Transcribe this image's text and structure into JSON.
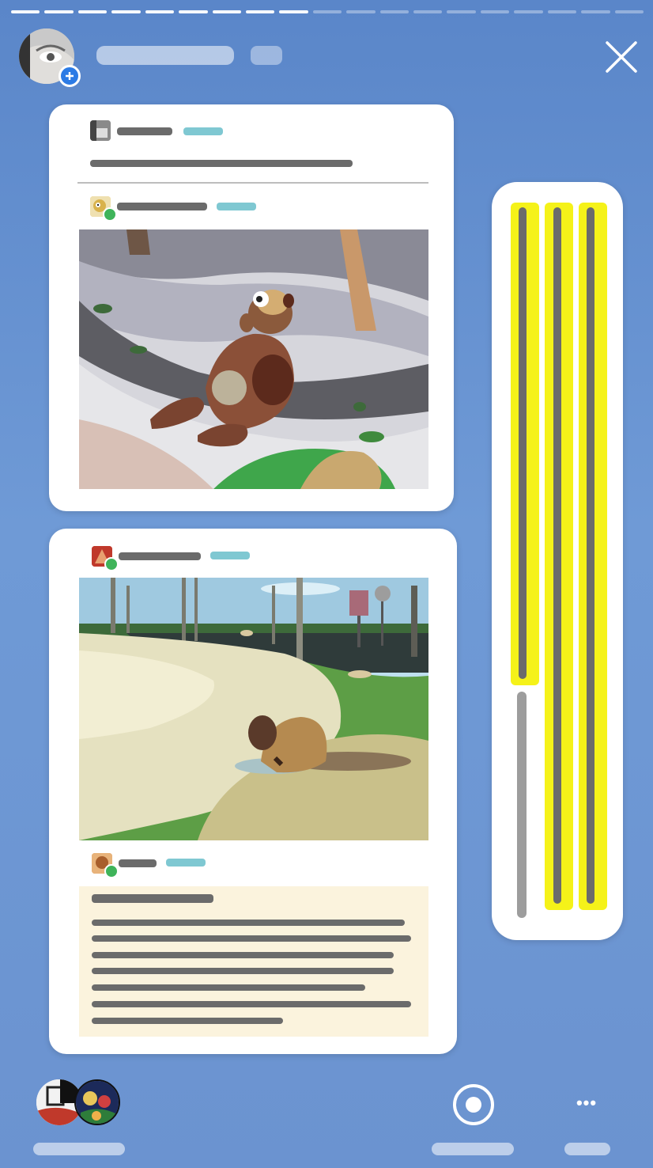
{
  "story": {
    "segments_total": 19,
    "segments_done": 9,
    "progress_fraction": 0.47
  },
  "header": {
    "avatar_icon": "user-eye-avatar",
    "add_icon": "plus-icon",
    "close_icon": "close-icon"
  },
  "footer": {
    "record_icon": "record-icon",
    "more_icon": "more-dots-icon",
    "more_label": "•••"
  },
  "colors": {
    "background": "#6b93d0",
    "highlight": "#f5f219",
    "teal_placeholder": "#7fc8d2",
    "text_placeholder": "#6b6b6b",
    "note_background": "#fbf3dd",
    "badge_green": "#3fb45a"
  }
}
